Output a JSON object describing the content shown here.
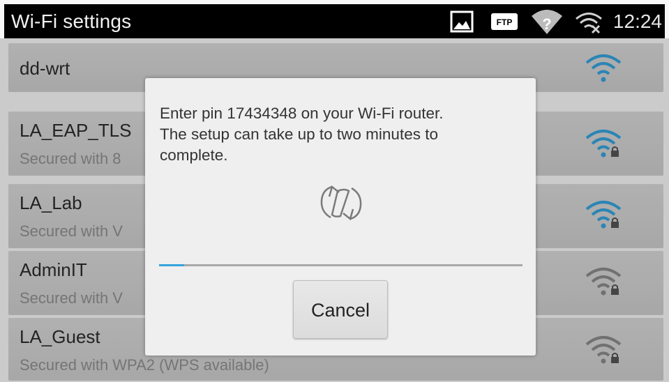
{
  "status_bar": {
    "title": "Wi-Fi settings",
    "time": "12:24",
    "icons": [
      "image-icon",
      "ftp-icon",
      "wifi-question-icon",
      "wifi-disconnected-icon"
    ],
    "ftp_label": "FTP"
  },
  "networks": [
    {
      "name": "dd-wrt",
      "subtitle": "",
      "secured": false,
      "signal_icon": "wifi-signal-icon"
    },
    {
      "name": "LA_EAP_TLS",
      "subtitle": "Secured with 8",
      "secured": true,
      "signal_icon": "wifi-signal-lock-icon"
    },
    {
      "name": "LA_Lab",
      "subtitle": "Secured with V",
      "secured": true,
      "signal_icon": "wifi-signal-lock-icon"
    },
    {
      "name": "AdminIT",
      "subtitle": "Secured with V",
      "secured": true,
      "signal_icon": "wifi-signal-lock-icon"
    },
    {
      "name": "LA_Guest",
      "subtitle": "Secured with WPA2 (WPS available)",
      "secured": true,
      "signal_icon": "wifi-signal-lock-icon"
    }
  ],
  "dialog": {
    "message": "Enter pin 17434348 on your Wi-Fi router.\nThe setup can take up to two minutes to\ncomplete.",
    "progress": 0.07,
    "cancel_label": "Cancel",
    "icon": "sync-icon"
  },
  "colors": {
    "accent": "#35a3dd",
    "wifi_gray": "#8a8a8a"
  }
}
